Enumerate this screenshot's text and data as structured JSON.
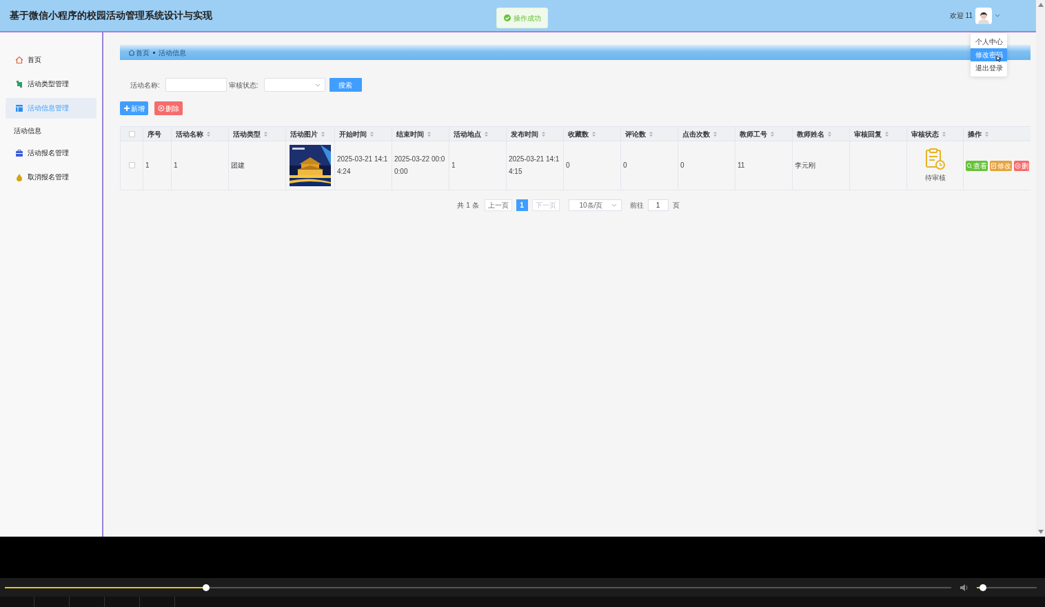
{
  "header": {
    "title": "基于微信小程序的校园活动管理系统设计与实现",
    "welcome": "欢迎 11"
  },
  "toast": {
    "message": "操作成功"
  },
  "user_menu": {
    "items": [
      {
        "label": "个人中心",
        "selected": false
      },
      {
        "label": "修改密码",
        "selected": true
      },
      {
        "label": "退出登录",
        "selected": false
      }
    ]
  },
  "sidebar": {
    "items": [
      {
        "kind": "link",
        "label": "首页",
        "selected": false
      },
      {
        "kind": "link",
        "label": "活动类型管理",
        "selected": false
      },
      {
        "kind": "link",
        "label": "活动信息管理",
        "selected": true
      },
      {
        "kind": "group",
        "label": "活动信息"
      },
      {
        "kind": "link",
        "label": "活动报名管理",
        "selected": false
      },
      {
        "kind": "link",
        "label": "取消报名管理",
        "selected": false
      }
    ]
  },
  "breadcrumb": [
    "首页",
    "活动信息"
  ],
  "search": {
    "fields": [
      {
        "kind": "text",
        "label": "活动名称:"
      },
      {
        "kind": "select",
        "label": "审核状态:"
      }
    ],
    "button": "搜索"
  },
  "actions": [
    {
      "kind": "add",
      "label": "新增"
    },
    {
      "kind": "delete",
      "label": "删除"
    }
  ],
  "table": {
    "header_checked": false,
    "columns": [
      {
        "label": "序号",
        "sortable": false
      },
      {
        "label": "活动名称",
        "sortable": true
      },
      {
        "label": "活动类型",
        "sortable": true
      },
      {
        "label": "活动图片",
        "sortable": true
      },
      {
        "label": "开始时间",
        "sortable": true
      },
      {
        "label": "结束时间",
        "sortable": true
      },
      {
        "label": "活动地点",
        "sortable": true
      },
      {
        "label": "发布时间",
        "sortable": true
      },
      {
        "label": "收藏数",
        "sortable": true
      },
      {
        "label": "评论数",
        "sortable": true
      },
      {
        "label": "点击次数",
        "sortable": true
      },
      {
        "label": "教师工号",
        "sortable": true
      },
      {
        "label": "教师姓名",
        "sortable": true
      },
      {
        "label": "审核回复",
        "sortable": true
      },
      {
        "label": "审核状态",
        "sortable": true
      },
      {
        "label": "操作",
        "sortable": true
      }
    ],
    "rows": [
      {
        "checked": false,
        "cells": [
          {
            "kind": "text",
            "text": "1"
          },
          {
            "kind": "text",
            "text": "1"
          },
          {
            "kind": "text",
            "text": "团建"
          },
          {
            "kind": "picture"
          },
          {
            "kind": "text",
            "text": "2025-03-21 14:14:24"
          },
          {
            "kind": "text",
            "text": "2025-03-22 00:00:00"
          },
          {
            "kind": "text",
            "text": "1"
          },
          {
            "kind": "text",
            "text": "2025-03-21 14:14:15"
          },
          {
            "kind": "text",
            "text": "0"
          },
          {
            "kind": "text",
            "text": "0"
          },
          {
            "kind": "text",
            "text": "0"
          },
          {
            "kind": "text",
            "text": "11"
          },
          {
            "kind": "text",
            "text": "李元刚"
          },
          {
            "kind": "empty"
          },
          {
            "kind": "status",
            "text": "待审核"
          },
          {
            "kind": "actions",
            "buttons": [
              {
                "kind": "view",
                "label": "查看"
              },
              {
                "kind": "edit",
                "label": "修改"
              },
              {
                "kind": "delete",
                "label": "删"
              }
            ]
          }
        ]
      }
    ]
  },
  "pagination": {
    "total": "共 1 条",
    "prev": {
      "label": "上一页",
      "disabled": false
    },
    "pages": [
      {
        "label": "1",
        "selected": true
      }
    ],
    "next": {
      "label": "下一页",
      "disabled": true
    },
    "page_size": "10条/页",
    "goto_label": "前往",
    "goto_value": "1",
    "page_suffix": "页"
  },
  "player": {
    "progress": {
      "level": 0.213
    },
    "volume": {
      "level": 0.1
    }
  }
}
